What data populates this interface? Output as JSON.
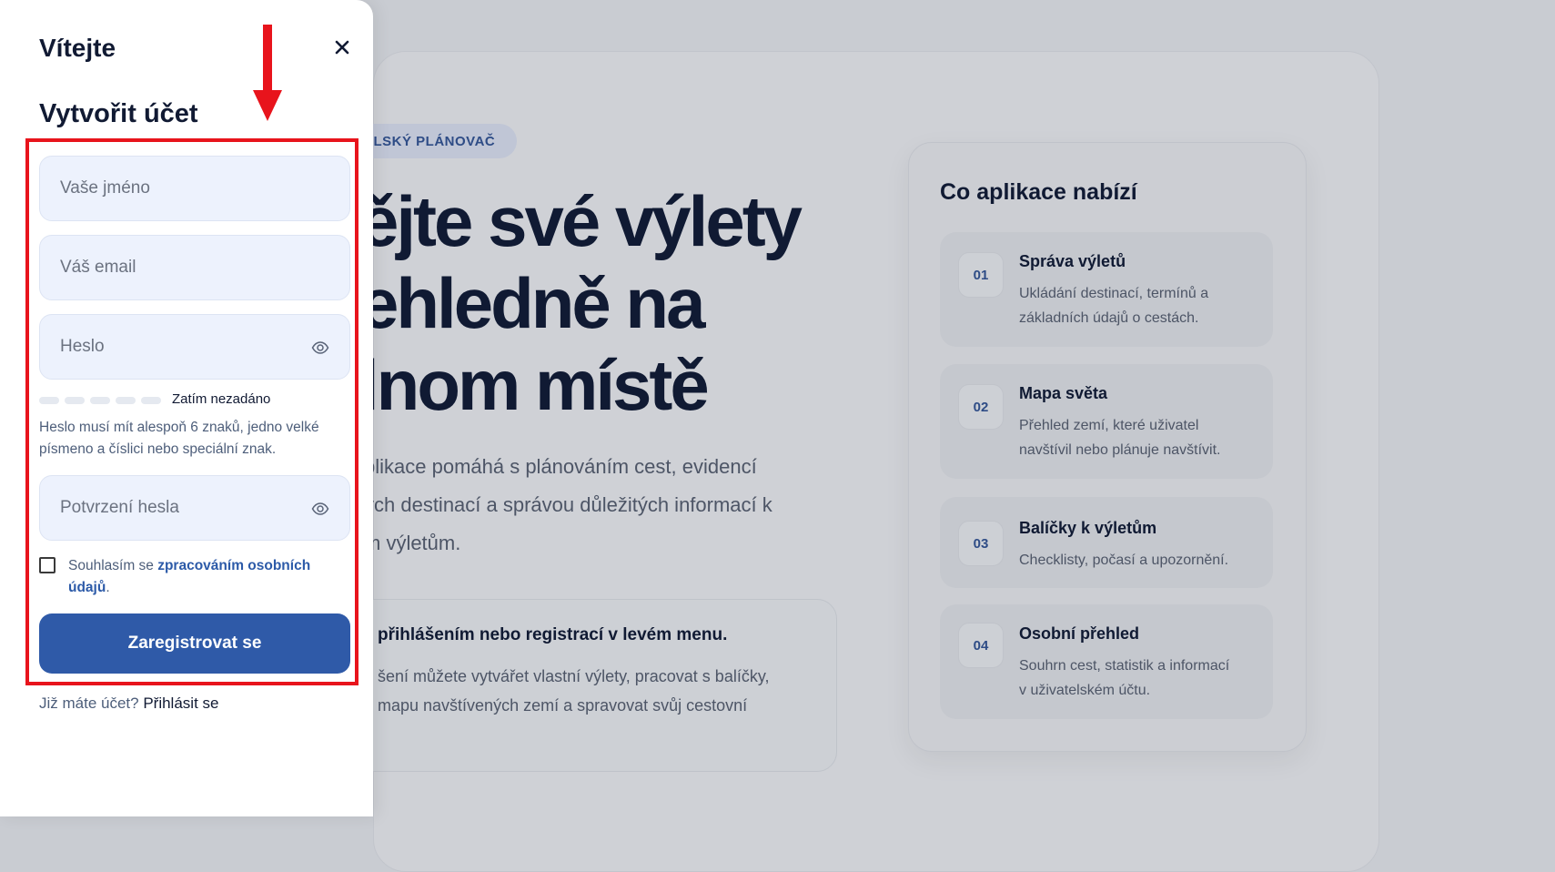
{
  "background": {
    "badge": "ELSKÝ PLÁNOVAČ",
    "hero_title_lines": [
      "ějte své výlety",
      "ehledně na",
      "lnom místě"
    ],
    "hero_desc_lines": [
      "plikace pomáhá s plánováním cest, evidencí",
      "ých destinací a správou důležitých informací k",
      "m výletům."
    ],
    "info_card": {
      "title": "přihlášením nebo registrací v levém menu.",
      "text_lines": [
        "šení můžete vytvářet vlastní výlety, pracovat s balíčky,",
        "mapu navštívených zemí a spravovat svůj cestovní"
      ]
    },
    "features": {
      "title": "Co aplikace nabízí",
      "items": [
        {
          "num": "01",
          "title": "Správa výletů",
          "desc_lines": [
            "Ukládání destinací, termínů a",
            "základních údajů o cestách."
          ]
        },
        {
          "num": "02",
          "title": "Mapa světa",
          "desc_lines": [
            "Přehled zemí, které uživatel",
            "navštívil nebo plánuje navštívit."
          ]
        },
        {
          "num": "03",
          "title": "Balíčky k výletům",
          "desc_lines": [
            "Checklisty, počasí a upozornění."
          ]
        },
        {
          "num": "04",
          "title": "Osobní přehled",
          "desc_lines": [
            "Souhrn cest, statistik a informací",
            "v uživatelském účtu."
          ]
        }
      ]
    }
  },
  "drawer": {
    "title": "Vítejte",
    "form_title": "Vytvořit účet",
    "fields": {
      "name_placeholder": "Vaše jméno",
      "email_placeholder": "Váš email",
      "password_placeholder": "Heslo",
      "confirm_placeholder": "Potvrzení hesla"
    },
    "strength_label": "Zatím nezadáno",
    "hint_lines": [
      "Heslo musí mít alespoň 6 znaků, jedno velké",
      "písmeno a číslici nebo speciální znak."
    ],
    "consent": {
      "prefix": "Souhlasím se ",
      "link": "zpracováním osobních údajů",
      "suffix": "."
    },
    "submit_label": "Zaregistrovat se",
    "login_prompt": "Již máte účet? ",
    "login_link": "Přihlásit se"
  },
  "colors": {
    "accent": "#2f5aa8",
    "highlight": "#e8141c",
    "field_bg": "#edf2fd"
  },
  "icons": [
    "close-icon",
    "eye-icon",
    "arrow-down-icon"
  ]
}
